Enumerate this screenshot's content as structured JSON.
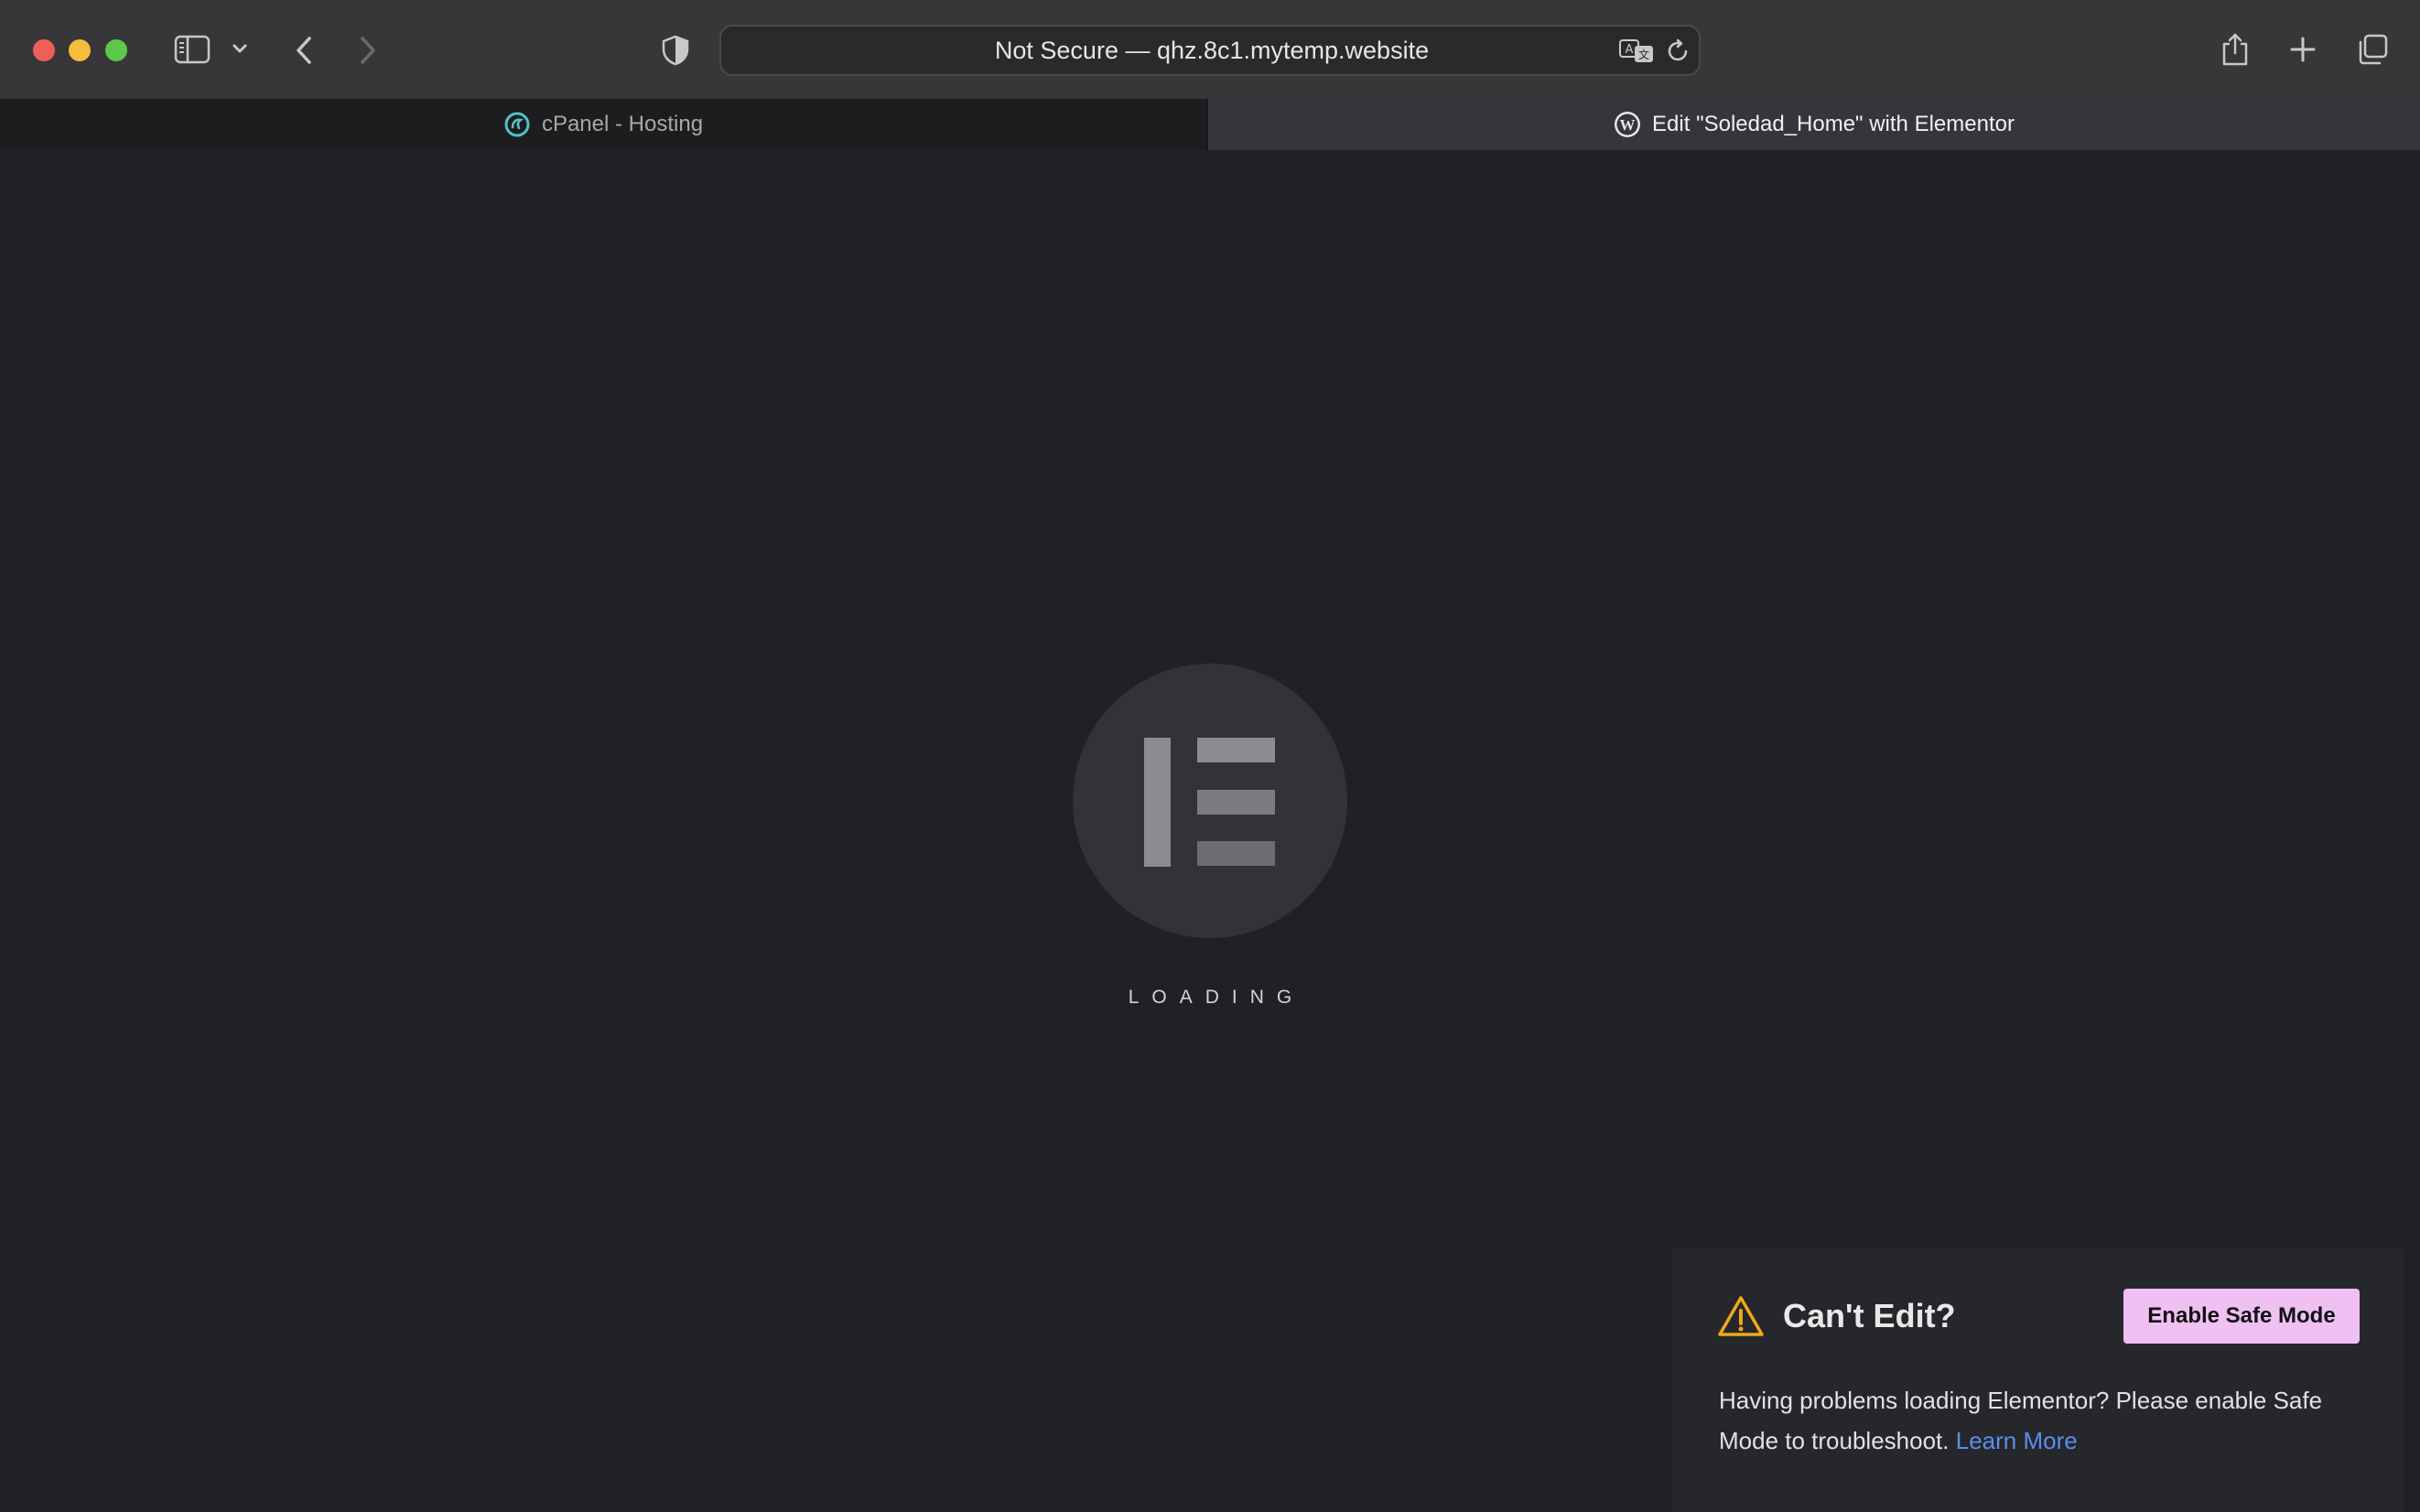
{
  "browser": {
    "address": "Not Secure — qhz.8c1.mytemp.website",
    "tabs": [
      {
        "label": "cPanel - Hosting",
        "icon": "cpanel-icon",
        "active": false
      },
      {
        "label": "Edit \"Soledad_Home\" with Elementor",
        "icon": "wordpress-icon",
        "active": true
      }
    ]
  },
  "loader": {
    "label": "LOADING",
    "icon": "elementor-logo-icon"
  },
  "safe_mode_panel": {
    "title": "Can't Edit?",
    "button_label": "Enable Safe Mode",
    "message": "Having problems loading Elementor? Please enable Safe Mode to troubleshoot.",
    "link_label": "Learn More"
  },
  "colors": {
    "background": "#202125",
    "button": "#f0c0f3",
    "link": "#5b8def",
    "warning": "#f0a81c"
  }
}
